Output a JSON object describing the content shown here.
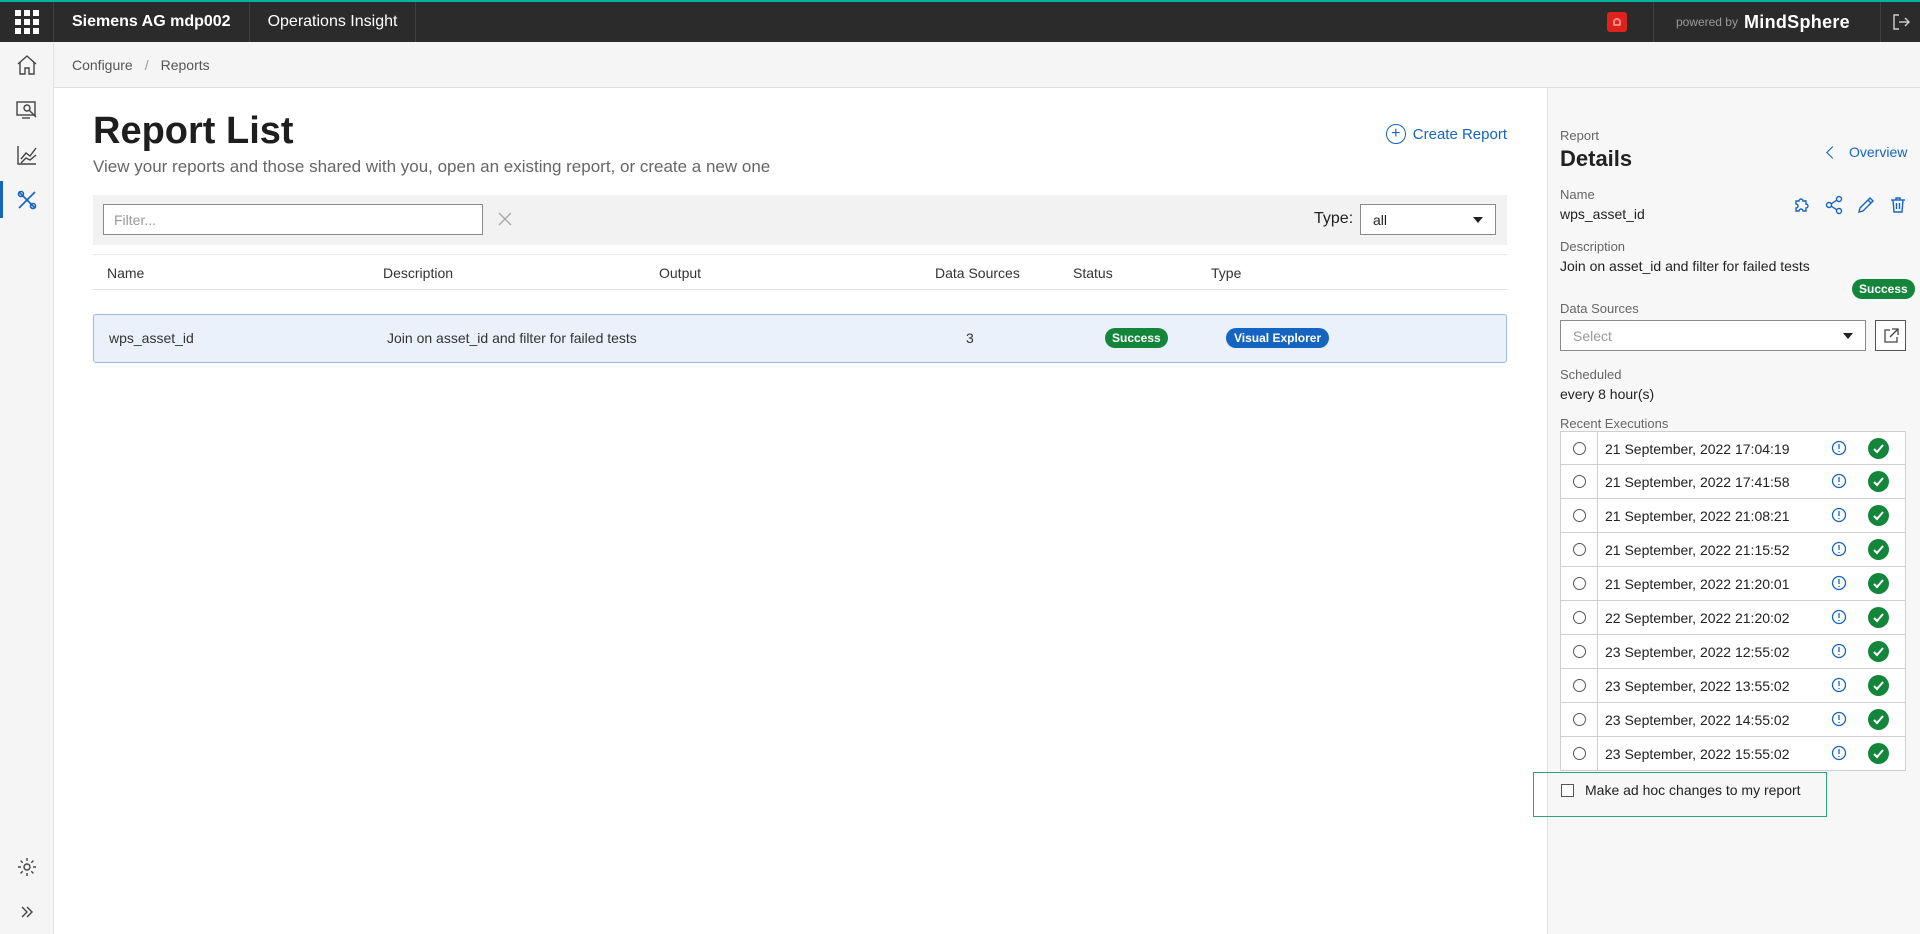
{
  "topbar": {
    "tenant": "Siemens AG mdp002",
    "app": "Operations Insight",
    "powered_by": "powered by",
    "brand": "MindSphere"
  },
  "nav": {
    "items": [
      {
        "icon": "home-icon"
      },
      {
        "icon": "monitor-search-icon"
      },
      {
        "icon": "chart-icon"
      },
      {
        "icon": "tools-icon",
        "active": true
      }
    ],
    "bottom": [
      {
        "icon": "gear-icon"
      },
      {
        "icon": "expand-icon"
      }
    ]
  },
  "breadcrumb": {
    "items": [
      "Configure",
      "Reports"
    ],
    "separator": "/"
  },
  "main": {
    "title": "Report List",
    "subtitle": "View your reports and those shared with you, open an existing report, or create a new one",
    "create_label": "Create Report",
    "filter_placeholder": "Filter...",
    "type_label": "Type:",
    "type_value": "all",
    "columns": [
      "Name",
      "Description",
      "Output",
      "Data Sources",
      "Status",
      "Type"
    ],
    "rows": [
      {
        "name": "wps_asset_id",
        "description": "Join on asset_id and filter for failed tests",
        "output": "",
        "data_sources": "3",
        "status": "Success",
        "type": "Visual Explorer"
      }
    ]
  },
  "panel": {
    "eyebrow": "Report",
    "title": "Details",
    "overview_label": "Overview",
    "name_label": "Name",
    "name_value": "wps_asset_id",
    "description_label": "Description",
    "description_value": "Join on asset_id and filter for failed tests",
    "status_badge": "Success",
    "data_sources_label": "Data Sources",
    "data_sources_placeholder": "Select",
    "scheduled_label": "Scheduled",
    "scheduled_value": "every 8 hour(s)",
    "recent_label": "Recent Executions",
    "executions": [
      "21 September, 2022 17:04:19",
      "21 September, 2022 17:41:58",
      "21 September, 2022 21:08:21",
      "21 September, 2022 21:15:52",
      "21 September, 2022 21:20:01",
      "22 September, 2022 21:20:02",
      "23 September, 2022 12:55:02",
      "23 September, 2022 13:55:02",
      "23 September, 2022 14:55:02",
      "23 September, 2022 15:55:02"
    ],
    "adhoc_label": "Make ad hoc changes to my report"
  },
  "colors": {
    "accent": "#1565c0",
    "success": "#13863c",
    "topbar": "#2b2b2b",
    "notification": "#e0221c"
  }
}
